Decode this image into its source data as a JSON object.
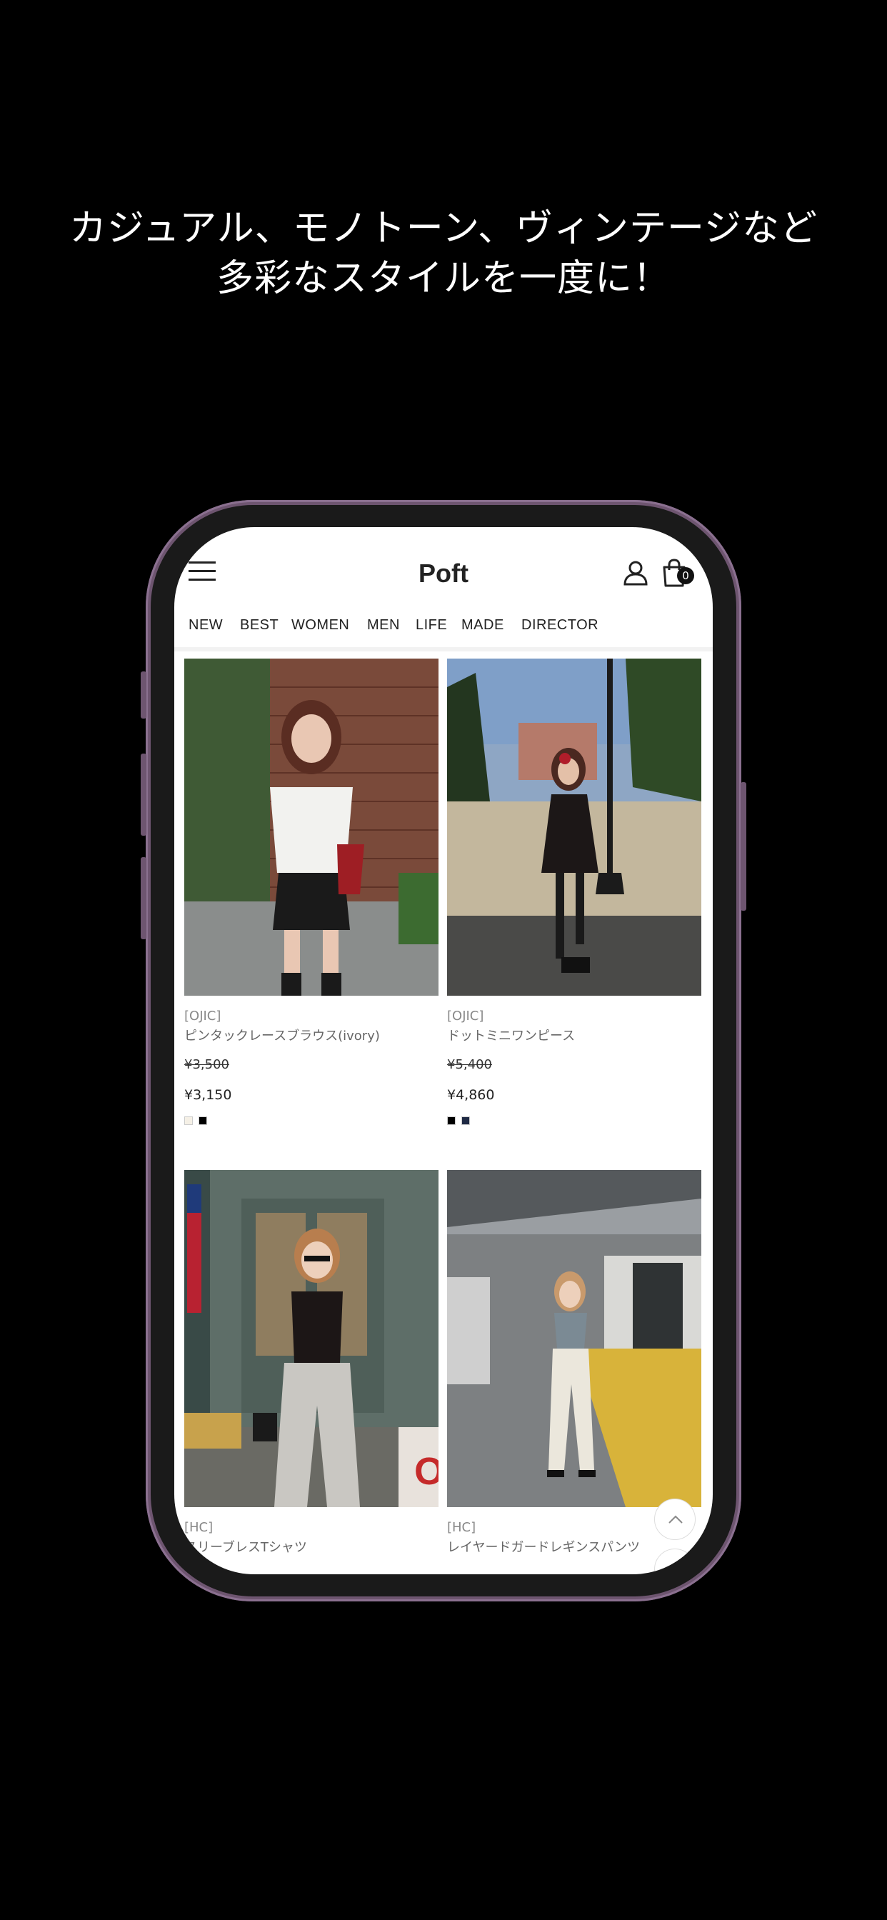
{
  "headline": {
    "line1": "カジュアル、モノトーン、ヴィンテージなど",
    "line2": "多彩なスタイルを一度に！"
  },
  "app": {
    "logo": "Poft",
    "cart_count": "0"
  },
  "nav": {
    "categories": [
      "NEW",
      "BEST",
      "WOMEN",
      "MEN",
      "LIFE",
      "MADE",
      "DIRECTOR"
    ]
  },
  "products": [
    {
      "brand": "[OJIC]",
      "name": "ピンタックレースブラウス(ivory)",
      "old_price": "¥3,500",
      "price": "¥3,150",
      "swatch_colors": [
        "#f5f0e6",
        "#000000"
      ]
    },
    {
      "brand": "[OJIC]",
      "name": "ドットミニワンピース",
      "old_price": "¥5,400",
      "price": "¥4,860",
      "swatch_colors": [
        "#000000",
        "#1f2a44"
      ]
    },
    {
      "brand": "[HC]",
      "name": "スリーブレスTシャツ"
    },
    {
      "brand": "[HC]",
      "name": "レイヤードガードレギンスパンツ"
    }
  ],
  "colors": {
    "background": "#000000",
    "phone_frame": "#6e5570",
    "text_primary": "#222222"
  }
}
